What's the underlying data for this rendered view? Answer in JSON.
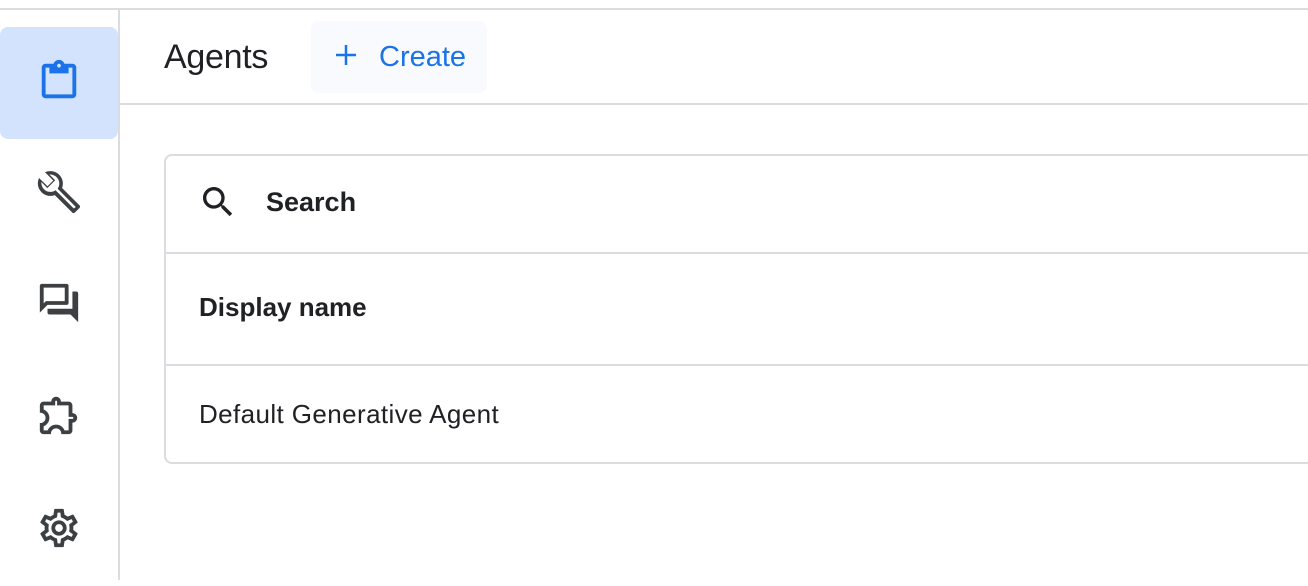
{
  "sidebar": {
    "items": [
      {
        "name": "agents",
        "icon": "clipboard-icon",
        "active": true
      },
      {
        "name": "tools",
        "icon": "wrench-icon",
        "active": false
      },
      {
        "name": "conversations",
        "icon": "forum-icon",
        "active": false
      },
      {
        "name": "extensions",
        "icon": "extension-icon",
        "active": false
      },
      {
        "name": "settings",
        "icon": "gear-icon",
        "active": false
      }
    ]
  },
  "header": {
    "title": "Agents",
    "create_label": "Create"
  },
  "search": {
    "placeholder": "Search"
  },
  "table": {
    "columns": [
      "Display name"
    ],
    "rows": [
      [
        "Default Generative Agent"
      ]
    ]
  },
  "colors": {
    "accent": "#1a73e8",
    "active_nav_bg": "#d3e3fd",
    "icon_dark": "#3c4043",
    "border": "#dadce0"
  }
}
